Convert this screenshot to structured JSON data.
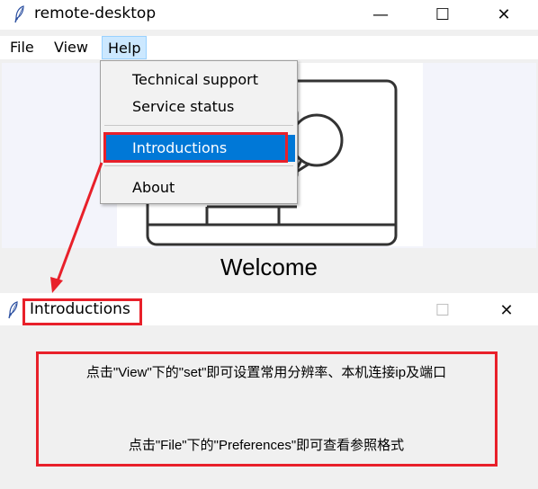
{
  "main_window": {
    "title": "remote-desktop",
    "controls": {
      "minimize": "—",
      "maximize": "☐",
      "close": "✕"
    },
    "menu": [
      "File",
      "View",
      "Help"
    ],
    "welcome_text": "Welcome"
  },
  "help_menu": {
    "items": [
      "Technical support",
      "Service status",
      "Introductions",
      "About"
    ],
    "highlighted": "Introductions"
  },
  "dialog": {
    "title": "Introductions",
    "controls": {
      "maximize": "☐",
      "close": "✕"
    },
    "line1": "点击\"View\"下的\"set\"即可设置常用分辨率、本机连接ip及端口",
    "line2": "点击\"File\"下的\"Preferences\"即可查看参照格式"
  },
  "colors": {
    "annotation_red": "#e8202a",
    "menu_highlight": "#0078d7",
    "menu_open": "#cce8ff"
  }
}
